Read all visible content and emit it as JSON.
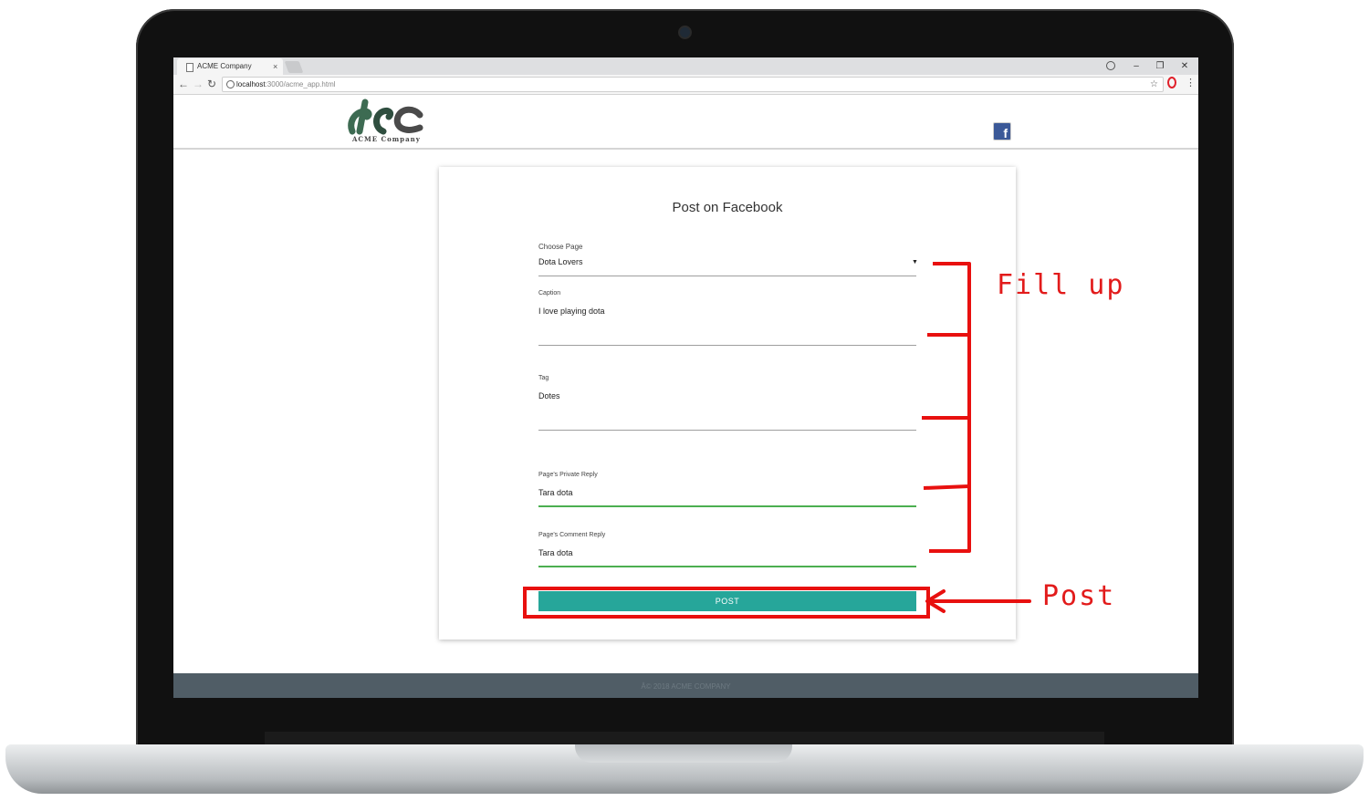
{
  "browser": {
    "tab_title": "ACME Company",
    "tab_close": "×",
    "window_controls": {
      "minimize": "–",
      "restore": "❐",
      "close": "✕"
    },
    "url_host": "localhost",
    "url_path": ":3000/acme_app.html",
    "icons": [
      "back-icon",
      "forward-icon",
      "reload-icon",
      "info-icon",
      "star-icon",
      "opera-icon",
      "menu-icon",
      "account-icon"
    ]
  },
  "header": {
    "logo_text": "ACME Company",
    "social": "facebook"
  },
  "form": {
    "title": "Post on Facebook",
    "page_select": {
      "label": "Choose Page",
      "value": "Dota Lovers",
      "caret": "▼"
    },
    "caption": {
      "label": "Caption",
      "value": "I love playing dota"
    },
    "tag": {
      "label": "Tag",
      "value": "Dotes"
    },
    "private_reply": {
      "label": "Page's Private Reply",
      "value": "Tara dota"
    },
    "comment_reply": {
      "label": "Page's Comment Reply",
      "value": "Tara dota"
    },
    "submit_label": "POST"
  },
  "footer": {
    "text": "Â© 2018 ACME COMPANY"
  },
  "annotations": {
    "fill_up": "Fill up",
    "post": "Post"
  },
  "colors": {
    "accent_teal": "#26a69a",
    "valid_green": "#4caf50",
    "annotation_red": "#e21b1b",
    "footer_bg": "#505d66",
    "facebook_blue": "#3b5998"
  }
}
